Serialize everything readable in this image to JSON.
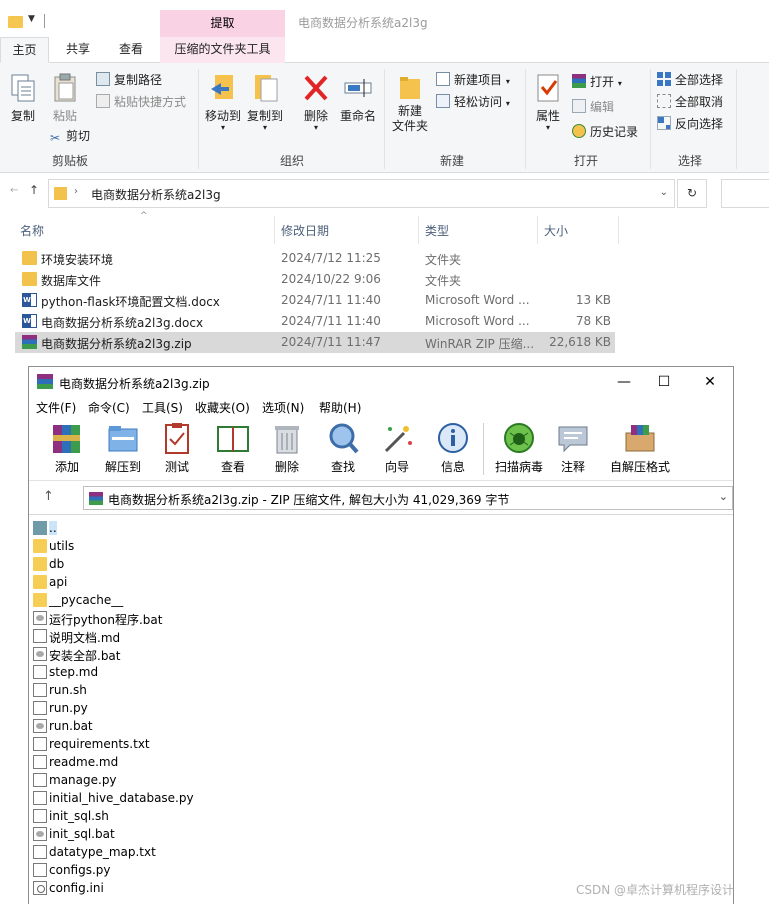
{
  "explorer": {
    "window_title": "电商数据分析系统a2l3g",
    "context_tab_title": "提取",
    "tabs": [
      "主页",
      "共享",
      "查看",
      "压缩的文件夹工具"
    ],
    "ribbon": {
      "clipboard": {
        "copy": "复制",
        "paste": "粘贴",
        "copy_path": "复制路径",
        "paste_shortcut": "粘贴快捷方式",
        "cut": "剪切",
        "label": "剪贴板"
      },
      "organize": {
        "move_to": "移动到",
        "copy_to": "复制到",
        "delete": "删除",
        "rename": "重命名",
        "label": "组织"
      },
      "new": {
        "new_folder": "新建\n文件夹",
        "new_item": "新建项目",
        "easy_access": "轻松访问",
        "label": "新建"
      },
      "open": {
        "properties": "属性",
        "open": "打开",
        "edit": "编辑",
        "history": "历史记录",
        "label": "打开"
      },
      "select": {
        "select_all": "全部选择",
        "select_none": "全部取消",
        "invert": "反向选择",
        "label": "选择"
      }
    },
    "address": "电商数据分析系统a2l3g",
    "columns": {
      "name": "名称",
      "date": "修改日期",
      "type": "类型",
      "size": "大小"
    },
    "files": [
      {
        "name": "环境安装环境",
        "date": "2024/7/12 11:25",
        "type": "文件夹",
        "size": "",
        "icon": "folder"
      },
      {
        "name": "数据库文件",
        "date": "2024/10/22 9:06",
        "type": "文件夹",
        "size": "",
        "icon": "folder"
      },
      {
        "name": "python-flask环境配置文档.docx",
        "date": "2024/7/11 11:40",
        "type": "Microsoft Word ...",
        "size": "13 KB",
        "icon": "word"
      },
      {
        "name": "电商数据分析系统a2l3g.docx",
        "date": "2024/7/11 11:40",
        "type": "Microsoft Word ...",
        "size": "78 KB",
        "icon": "word"
      },
      {
        "name": "电商数据分析系统a2l3g.zip",
        "date": "2024/7/11 11:47",
        "type": "WinRAR ZIP 压缩...",
        "size": "22,618 KB",
        "icon": "rar",
        "selected": true
      }
    ]
  },
  "winrar": {
    "title": "电商数据分析系统a2l3g.zip",
    "menu": [
      "文件(F)",
      "命令(C)",
      "工具(S)",
      "收藏夹(O)",
      "选项(N)",
      "帮助(H)"
    ],
    "toolbar": [
      "添加",
      "解压到",
      "测试",
      "查看",
      "删除",
      "查找",
      "向导",
      "信息",
      "扫描病毒",
      "注释",
      "自解压格式"
    ],
    "path": "电商数据分析系统a2l3g.zip - ZIP 压缩文件, 解包大小为 41,029,369 字节",
    "entries": [
      {
        "name": "..",
        "icon": "up"
      },
      {
        "name": "utils",
        "icon": "folder"
      },
      {
        "name": "db",
        "icon": "folder"
      },
      {
        "name": "api",
        "icon": "folder"
      },
      {
        "name": "__pycache__",
        "icon": "folder"
      },
      {
        "name": "运行python程序.bat",
        "icon": "bat"
      },
      {
        "name": "说明文档.md",
        "icon": "file"
      },
      {
        "name": "安装全部.bat",
        "icon": "bat"
      },
      {
        "name": "step.md",
        "icon": "file"
      },
      {
        "name": "run.sh",
        "icon": "file"
      },
      {
        "name": "run.py",
        "icon": "file"
      },
      {
        "name": "run.bat",
        "icon": "bat"
      },
      {
        "name": "requirements.txt",
        "icon": "file"
      },
      {
        "name": "readme.md",
        "icon": "file"
      },
      {
        "name": "manage.py",
        "icon": "file"
      },
      {
        "name": "initial_hive_database.py",
        "icon": "file"
      },
      {
        "name": "init_sql.sh",
        "icon": "file"
      },
      {
        "name": "init_sql.bat",
        "icon": "bat"
      },
      {
        "name": "datatype_map.txt",
        "icon": "file"
      },
      {
        "name": "configs.py",
        "icon": "file"
      },
      {
        "name": "config.ini",
        "icon": "cfg"
      }
    ]
  },
  "watermark": "CSDN @卓杰计算机程序设计",
  "colors": {
    "context_tab": "#f9d2e4",
    "selection": "#d9d9d9",
    "folder": "#f3c24c",
    "word_blue": "#2b579a"
  }
}
